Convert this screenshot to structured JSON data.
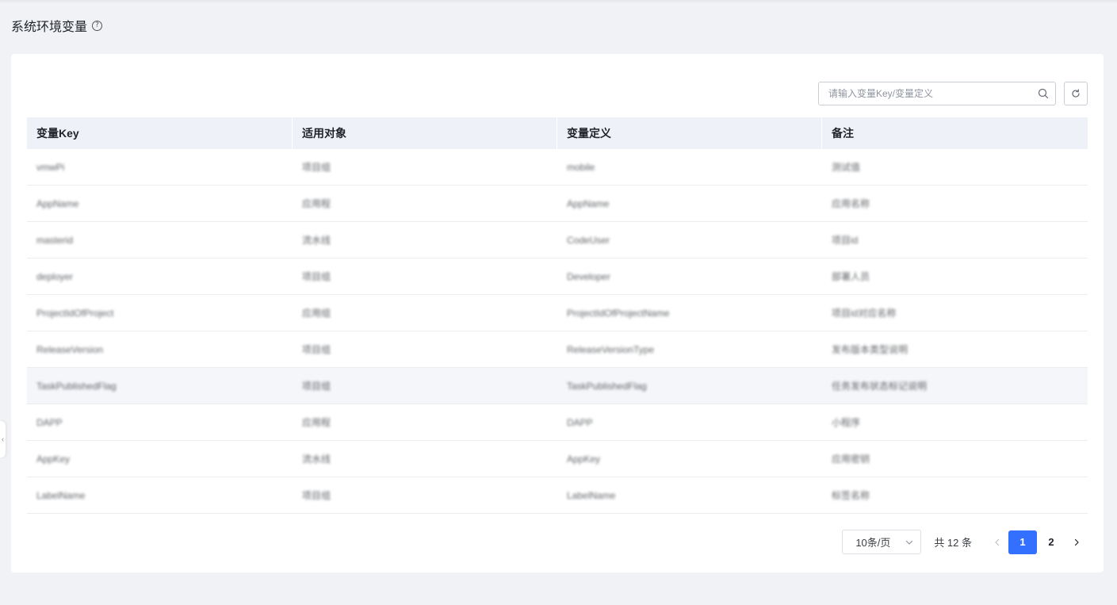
{
  "header": {
    "title": "系统环境变量",
    "help_icon": "question-circle-icon"
  },
  "toolbar": {
    "search_placeholder": "请输入变量Key/变量定义",
    "search_value": "",
    "search_icon": "search-icon",
    "refresh_icon": "refresh-icon"
  },
  "table": {
    "columns": [
      "变量Key",
      "适用对象",
      "变量定义",
      "备注"
    ],
    "rows": [
      [
        "vmwPi",
        "项目组",
        "mobile",
        "测试值"
      ],
      [
        "AppName",
        "应用程",
        "AppName",
        "应用名称"
      ],
      [
        "masterid",
        "流水线",
        "CodeUser",
        "项目id"
      ],
      [
        "deployer",
        "项目组",
        "Developer",
        "部署人员"
      ],
      [
        "ProjectIdOfProject",
        "应用组",
        "ProjectIdOfProjectName",
        "项目id对应名称"
      ],
      [
        "ReleaseVersion",
        "项目组",
        "ReleaseVersionType",
        "发布版本类型说明"
      ],
      [
        "TaskPublishedFlag",
        "项目组",
        "TaskPublishedFlag",
        "任务发布状态标记说明"
      ],
      [
        "DAPP",
        "应用程",
        "DAPP",
        "小程序"
      ],
      [
        "AppKey",
        "流水线",
        "AppKey",
        "应用密钥"
      ],
      [
        "LabelName",
        "项目组",
        "LabelName",
        "标签名称"
      ]
    ],
    "highlighted_row": 6
  },
  "pagination": {
    "page_size_label": "10条/页",
    "total_label": "共 12 条",
    "pages": [
      "1",
      "2"
    ],
    "current_page": "1",
    "prev_icon": "chevron-left-icon",
    "next_icon": "chevron-right-icon",
    "dropdown_icon": "chevron-down-icon"
  },
  "colors": {
    "accent": "#3370ff",
    "header_bg": "#eef1f8",
    "page_bg": "#f0f2f5"
  }
}
